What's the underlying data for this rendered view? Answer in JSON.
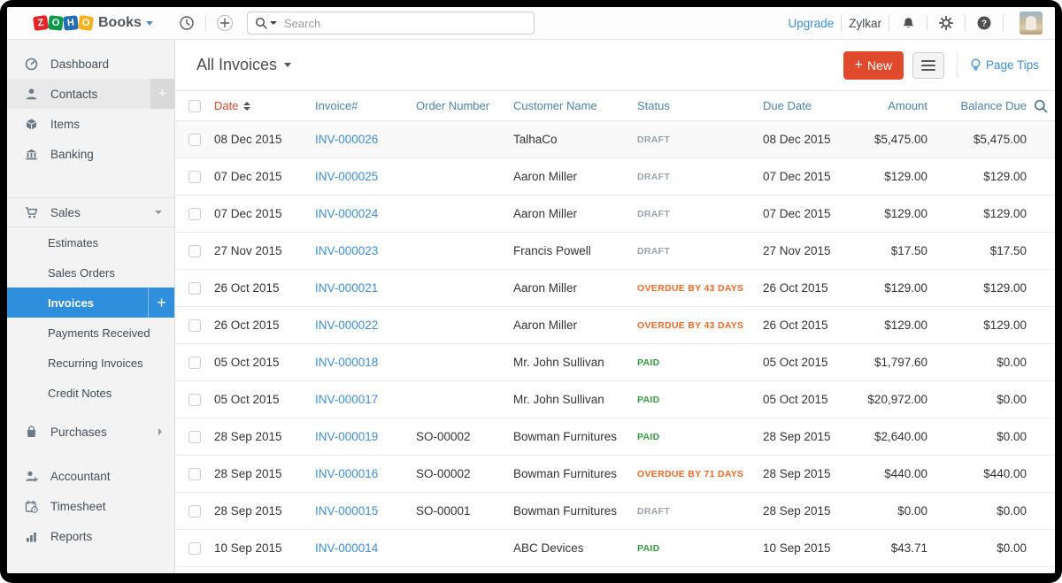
{
  "topbar": {
    "logo_letters": [
      "Z",
      "O",
      "H",
      "O"
    ],
    "product_name": "Books",
    "search_placeholder": "Search",
    "upgrade_label": "Upgrade",
    "org_name": "Zylkar"
  },
  "sidebar": {
    "dashboard": "Dashboard",
    "contacts": "Contacts",
    "items": "Items",
    "banking": "Banking",
    "sales": "Sales",
    "estimates": "Estimates",
    "sales_orders": "Sales Orders",
    "invoices": "Invoices",
    "payments_received": "Payments Received",
    "recurring_invoices": "Recurring Invoices",
    "credit_notes": "Credit Notes",
    "purchases": "Purchases",
    "accountant": "Accountant",
    "timesheet": "Timesheet",
    "reports": "Reports",
    "contacts_plus": "+",
    "invoices_plus": "+"
  },
  "page": {
    "title": "All Invoices",
    "new_button_label": "New",
    "new_button_plus": "+",
    "page_tips_label": "Page Tips"
  },
  "table": {
    "columns": {
      "date": "Date",
      "invoice": "Invoice#",
      "order": "Order Number",
      "customer": "Customer Name",
      "status": "Status",
      "due": "Due Date",
      "amount": "Amount",
      "balance": "Balance Due"
    },
    "rows": [
      {
        "date": "08 Dec 2015",
        "invoice": "INV-000026",
        "order": "",
        "customer": "TalhaCo",
        "status": "DRAFT",
        "status_type": "draft",
        "due": "08 Dec 2015",
        "amount": "$5,475.00",
        "balance": "$5,475.00"
      },
      {
        "date": "07 Dec 2015",
        "invoice": "INV-000025",
        "order": "",
        "customer": "Aaron Miller",
        "status": "DRAFT",
        "status_type": "draft",
        "due": "07 Dec 2015",
        "amount": "$129.00",
        "balance": "$129.00"
      },
      {
        "date": "07 Dec 2015",
        "invoice": "INV-000024",
        "order": "",
        "customer": "Aaron Miller",
        "status": "DRAFT",
        "status_type": "draft",
        "due": "07 Dec 2015",
        "amount": "$129.00",
        "balance": "$129.00"
      },
      {
        "date": "27 Nov 2015",
        "invoice": "INV-000023",
        "order": "",
        "customer": "Francis Powell",
        "status": "DRAFT",
        "status_type": "draft",
        "due": "27 Nov 2015",
        "amount": "$17.50",
        "balance": "$17.50"
      },
      {
        "date": "26 Oct 2015",
        "invoice": "INV-000021",
        "order": "",
        "customer": "Aaron Miller",
        "status": "OVERDUE BY 43 DAYS",
        "status_type": "overdue",
        "due": "26 Oct 2015",
        "amount": "$129.00",
        "balance": "$129.00"
      },
      {
        "date": "26 Oct 2015",
        "invoice": "INV-000022",
        "order": "",
        "customer": "Aaron Miller",
        "status": "OVERDUE BY 43 DAYS",
        "status_type": "overdue",
        "due": "26 Oct 2015",
        "amount": "$129.00",
        "balance": "$129.00"
      },
      {
        "date": "05 Oct 2015",
        "invoice": "INV-000018",
        "order": "",
        "customer": "Mr. John Sullivan",
        "status": "PAID",
        "status_type": "paid",
        "due": "05 Oct 2015",
        "amount": "$1,797.60",
        "balance": "$0.00"
      },
      {
        "date": "05 Oct 2015",
        "invoice": "INV-000017",
        "order": "",
        "customer": "Mr. John Sullivan",
        "status": "PAID",
        "status_type": "paid",
        "due": "05 Oct 2015",
        "amount": "$20,972.00",
        "balance": "$0.00"
      },
      {
        "date": "28 Sep 2015",
        "invoice": "INV-000019",
        "order": "SO-00002",
        "customer": "Bowman Furnitures",
        "status": "PAID",
        "status_type": "paid",
        "due": "28 Sep 2015",
        "amount": "$2,640.00",
        "balance": "$0.00"
      },
      {
        "date": "28 Sep 2015",
        "invoice": "INV-000016",
        "order": "SO-00002",
        "customer": "Bowman Furnitures",
        "status": "OVERDUE BY 71 DAYS",
        "status_type": "overdue",
        "due": "28 Sep 2015",
        "amount": "$440.00",
        "balance": "$440.00"
      },
      {
        "date": "28 Sep 2015",
        "invoice": "INV-000015",
        "order": "SO-00001",
        "customer": "Bowman Furnitures",
        "status": "DRAFT",
        "status_type": "draft",
        "due": "28 Sep 2015",
        "amount": "$0.00",
        "balance": "$0.00"
      },
      {
        "date": "10 Sep 2015",
        "invoice": "INV-000014",
        "order": "",
        "customer": "ABC Devices",
        "status": "PAID",
        "status_type": "paid",
        "due": "10 Sep 2015",
        "amount": "$43.71",
        "balance": "$0.00"
      }
    ]
  },
  "colors": {
    "brand_red": "#e42527",
    "brand_green": "#089949",
    "brand_blue": "#226db4",
    "brand_yellow": "#f9b21d",
    "selected_blue": "#2f8fdc",
    "new_button_red": "#de4a2b",
    "link_blue": "#3e8ed8",
    "header_blue": "#4d82aa",
    "date_header_red": "#e8472f",
    "status_draft": "#99a3ab",
    "status_overdue": "#f26a28",
    "status_paid": "#35993f"
  }
}
